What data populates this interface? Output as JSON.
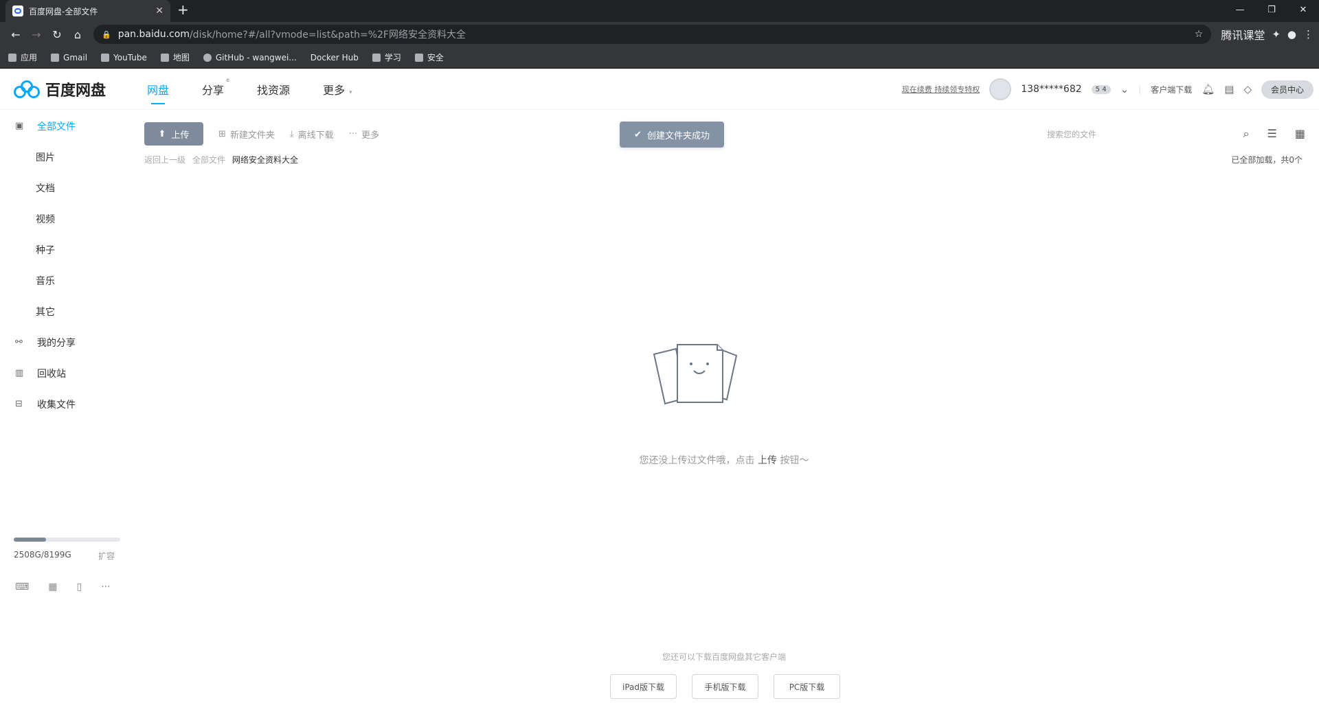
{
  "browser": {
    "tab_title": "百度网盘-全部文件",
    "new_tab": "+",
    "close": "✕",
    "url_host": "pan.baidu.com",
    "url_path": "/disk/home?#/all?vmode=list&path=%2F网络安全资料大全",
    "extension_text": "腾讯课堂",
    "bookmarks": [
      {
        "label": "应用"
      },
      {
        "label": "Gmail"
      },
      {
        "label": "YouTube"
      },
      {
        "label": "地图"
      },
      {
        "label": "GitHub - wangwei..."
      },
      {
        "label": "Docker Hub"
      },
      {
        "label": "学习"
      },
      {
        "label": "安全"
      }
    ]
  },
  "header": {
    "logo_text": "百度网盘",
    "nav": [
      {
        "label": "网盘",
        "active": true
      },
      {
        "label": "分享"
      },
      {
        "label": "找资源"
      },
      {
        "label": "更多"
      }
    ],
    "promo": "现在续费 持续领专特权",
    "username": "138*****682",
    "vip_badge": "5 4",
    "client_download": "客户端下载",
    "member_center": "会员中心"
  },
  "sidebar": {
    "items": [
      {
        "label": "全部文件"
      },
      {
        "label": "图片"
      },
      {
        "label": "文档"
      },
      {
        "label": "视频"
      },
      {
        "label": "种子"
      },
      {
        "label": "音乐"
      },
      {
        "label": "其它"
      },
      {
        "label": "我的分享"
      },
      {
        "label": "回收站"
      },
      {
        "label": "收集文件"
      }
    ],
    "quota_text": "2508G/8199G",
    "quota_fraction": 0.306,
    "expand": "扩容"
  },
  "toolbar": {
    "upload": "上传",
    "new_folder": "新建文件夹",
    "offline_download": "离线下载",
    "more": "更多",
    "toast": "创建文件夹成功",
    "search_placeholder": "搜索您的文件"
  },
  "breadcrumb": {
    "back": "返回上一级",
    "root": "全部文件",
    "current": "网络安全资料大全"
  },
  "loaded_status": "已全部加载，共0个",
  "empty": {
    "tip_prefix": "您还没上传过文件哦，点击",
    "tip_link": "上传",
    "tip_suffix": "按钮～"
  },
  "download": {
    "tip": "您还可以下载百度网盘其它客户端",
    "buttons": [
      "iPad版下载",
      "手机版下载",
      "PC版下载"
    ]
  }
}
